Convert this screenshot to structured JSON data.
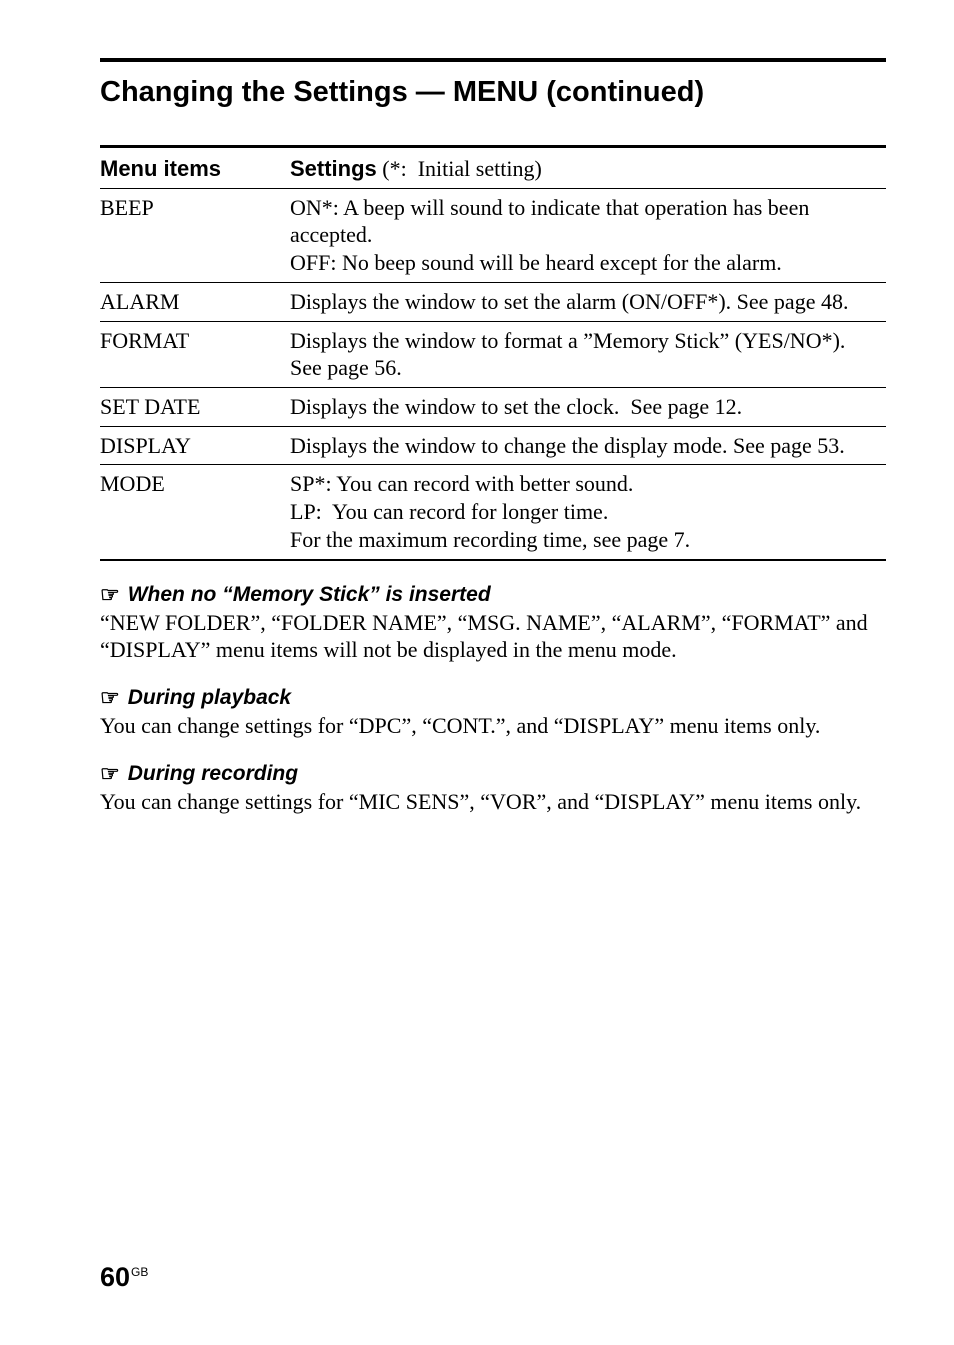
{
  "title": "Changing the Settings — MENU (continued)",
  "table": {
    "header": {
      "menu": "Menu items",
      "settings_label": "Settings",
      "settings_note": " (*:  Initial setting)"
    },
    "rows": [
      {
        "menu": "BEEP",
        "settings": "ON*: A beep will sound to indicate that operation has been accepted.\nOFF: No beep sound will be heard except for the alarm."
      },
      {
        "menu": "ALARM",
        "settings": "Displays the window to set the alarm (ON/OFF*). See page 48."
      },
      {
        "menu": "FORMAT",
        "settings": "Displays the window to format a ”Memory Stick” (YES/NO*).  See page 56."
      },
      {
        "menu": "SET DATE",
        "settings": "Displays the window to set the clock.  See page 12."
      },
      {
        "menu": "DISPLAY",
        "settings": "Displays the window to change the display mode. See page 53."
      },
      {
        "menu": "MODE",
        "settings": "SP*: You can record with better sound.\nLP:  You can record for longer time.\nFor the maximum recording time, see page 7."
      }
    ]
  },
  "icons": {
    "hand": "☞"
  },
  "sections": [
    {
      "heading": "When no “Memory Stick” is inserted",
      "body": "“NEW FOLDER”, “FOLDER NAME”, “MSG. NAME”, “ALARM”, “FORMAT” and “DISPLAY” menu items will not be displayed in the menu mode."
    },
    {
      "heading": "During playback",
      "body": "You can change settings for “DPC”, “CONT.”, and “DISPLAY” menu items only."
    },
    {
      "heading": "During recording",
      "body": "You can change settings for “MIC SENS”, “VOR”, and “DISPLAY” menu items only."
    }
  ],
  "page": {
    "number": "60",
    "suffix": "GB"
  }
}
